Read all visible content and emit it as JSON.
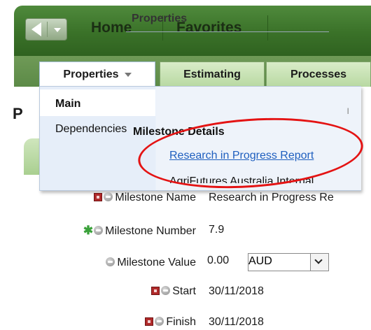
{
  "topnav": {
    "home": "Home",
    "favorites": "Favorites"
  },
  "tabs": [
    {
      "label": "Properties"
    },
    {
      "label": "Estimating"
    },
    {
      "label": "Processes"
    }
  ],
  "page": {
    "title_partial": "P",
    "right_fragment": "ı"
  },
  "menu": {
    "left_items": [
      "Main",
      "Dependencies"
    ],
    "right_header": "Properties",
    "section_title": "Milestone Details",
    "link": "Research in Progress Report",
    "partial_item": "AgriFutures Australia Internal"
  },
  "form": {
    "milestone_name_label": "Milestone Name",
    "milestone_name_value": "Research in Progress Re",
    "milestone_number_label": "Milestone Number",
    "milestone_number_value": "7.9",
    "milestone_value_label": "Milestone Value",
    "milestone_value_amount": "0.00",
    "milestone_value_currency": "AUD",
    "start_label": "Start",
    "start_value": "30/11/2018",
    "finish_label": "Finish",
    "finish_value": "30/11/2018"
  },
  "colors": {
    "nav_green": "#3a7128",
    "highlight_red": "#e41313",
    "link_blue": "#1f5fbf"
  }
}
